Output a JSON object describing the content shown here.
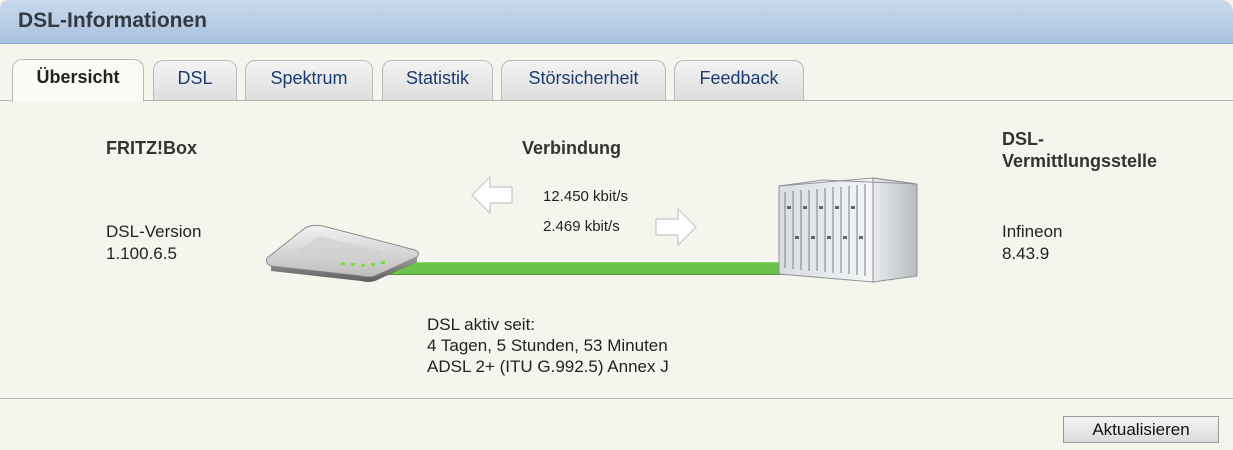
{
  "header": {
    "title": "DSL-Informationen"
  },
  "tabs": [
    {
      "label": "Übersicht",
      "active": true
    },
    {
      "label": "DSL"
    },
    {
      "label": "Spektrum"
    },
    {
      "label": "Statistik"
    },
    {
      "label": "Störsicherheit"
    },
    {
      "label": "Feedback"
    }
  ],
  "fritzbox": {
    "heading": "FRITZ!Box",
    "version_label": "DSL-Version",
    "version_value": "1.100.6.5"
  },
  "connection": {
    "heading": "Verbindung",
    "downstream": "12.450 kbit/s",
    "upstream": "2.469 kbit/s",
    "active_since_label": "DSL aktiv seit:",
    "active_since_value": "4 Tagen, 5 Stunden, 53 Minuten",
    "mode": "ADSL 2+ (ITU G.992.5) Annex J",
    "line_color": "#6cc24a"
  },
  "exchange": {
    "heading_line1": "DSL-",
    "heading_line2": "Vermittlungsstelle",
    "vendor": "Infineon",
    "version": "8.43.9"
  },
  "footer": {
    "refresh_label": "Aktualisieren"
  }
}
